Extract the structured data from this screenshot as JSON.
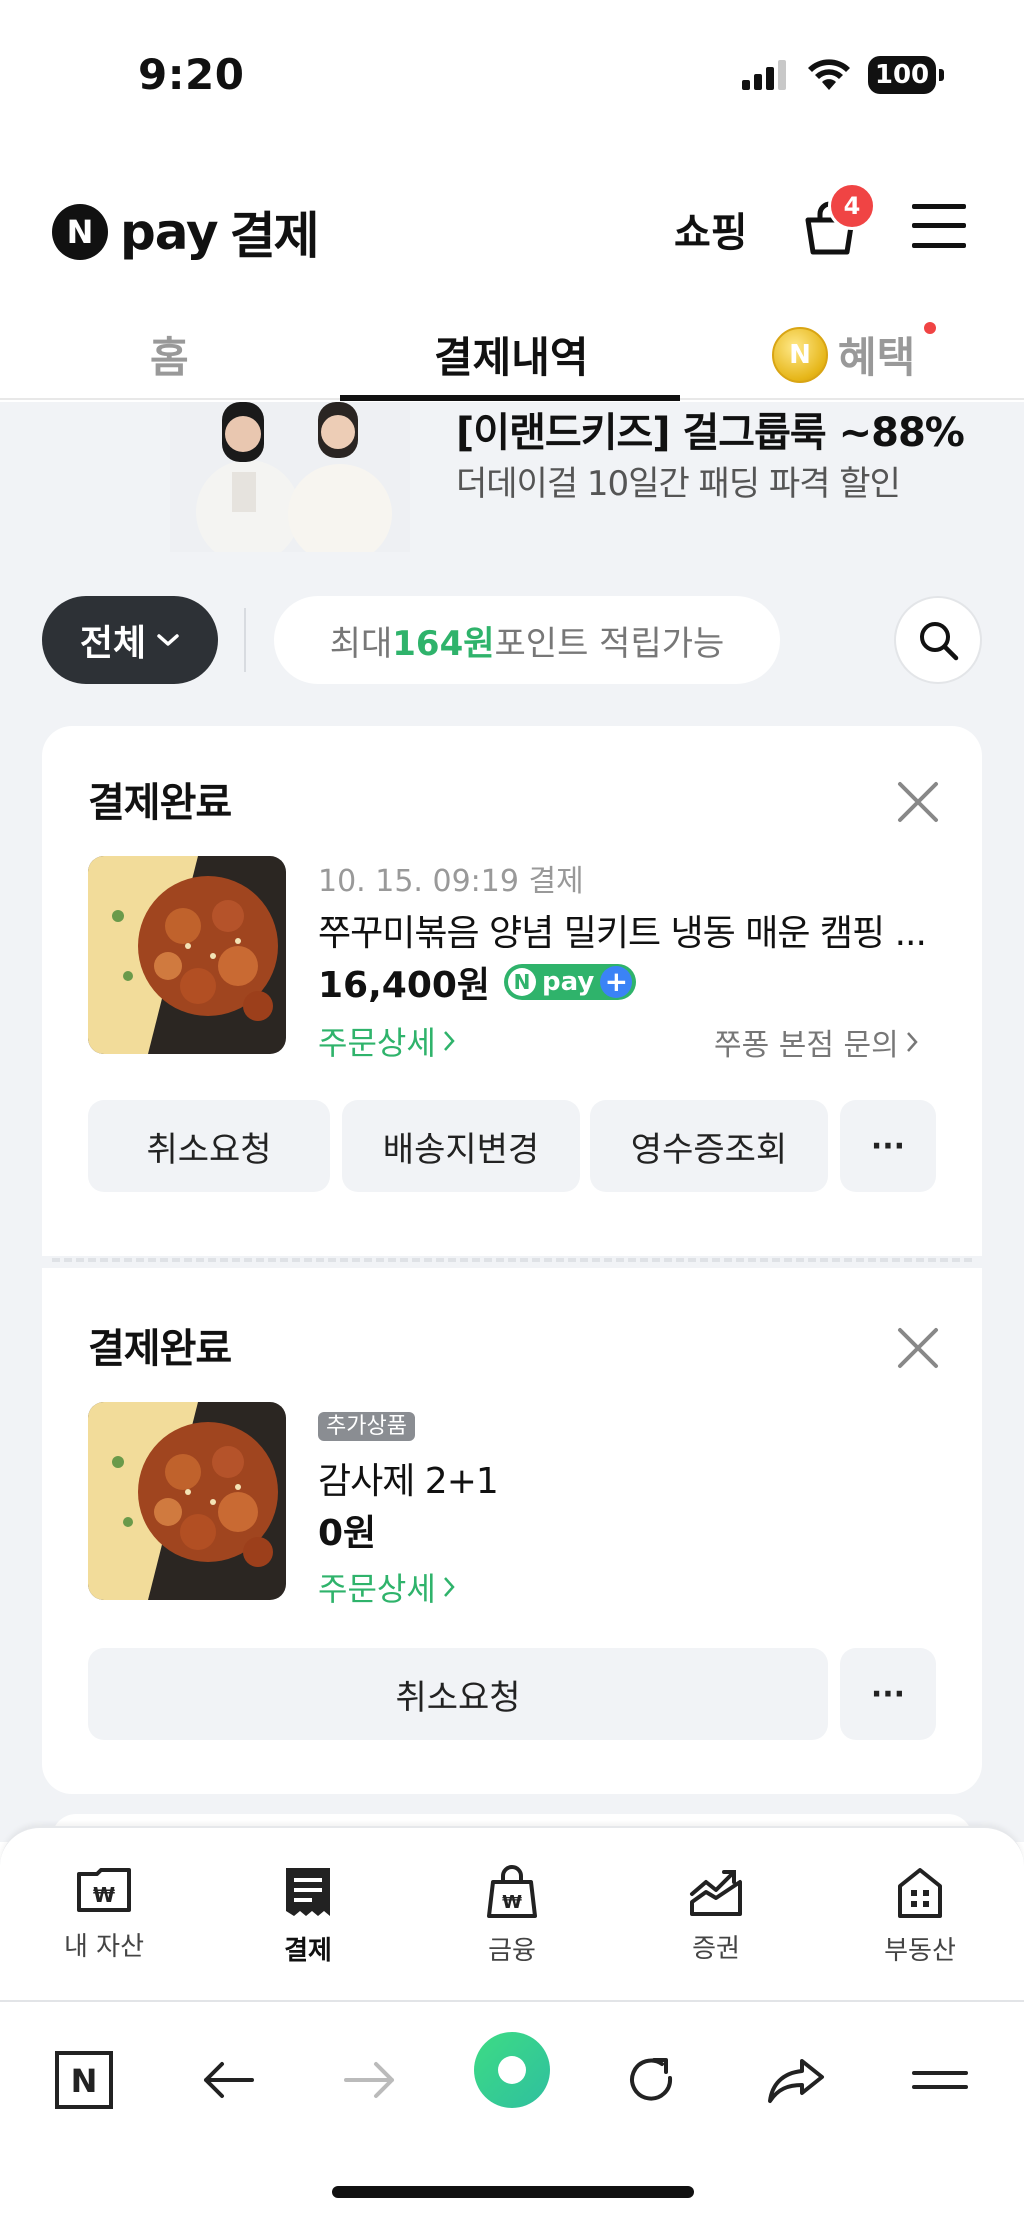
{
  "status_bar": {
    "time": "9:20",
    "battery": "100"
  },
  "header": {
    "brand_n": "N",
    "brand_pay": "pay",
    "brand_title": "결제",
    "shopping_label": "쇼핑",
    "cart_count": "4"
  },
  "tabs": [
    {
      "label": "홈"
    },
    {
      "label": "결제내역"
    },
    {
      "label": "혜택",
      "coin": "N"
    }
  ],
  "banner": {
    "title": "[이랜드키즈] 걸그룹룩 ~88%",
    "subtitle": "더데이걸 10일간 패딩 파격 할인"
  },
  "filter": {
    "all_label": "전체",
    "points_prefix": "최대 ",
    "points_amount": "164원",
    "points_suffix": " 포인트 적립가능"
  },
  "orders": [
    {
      "status": "결제완료",
      "date": "10. 15. 09:19 결제",
      "name": "쭈꾸미볶음 양념 밀키트 냉동 매운 캠핑 ...",
      "price": "16,400원",
      "badge_n": "N",
      "badge_pay": "pay",
      "badge_plus": "+",
      "detail_link": "주문상세",
      "store_inquiry": "쭈퐁 본점 문의",
      "actions": [
        "취소요청",
        "배송지변경",
        "영수증조회"
      ],
      "more_label": "···"
    },
    {
      "status": "결제완료",
      "tag": "추가상품",
      "name": "감사제 2+1",
      "price": "0원",
      "detail_link": "주문상세",
      "actions": [
        "취소요청"
      ],
      "more_label": "···"
    }
  ],
  "bottom_nav": [
    {
      "label": "내 자산",
      "icon": "wallet-icon"
    },
    {
      "label": "결제",
      "icon": "receipt-icon",
      "active": true
    },
    {
      "label": "금융",
      "icon": "money-bag-icon"
    },
    {
      "label": "증권",
      "icon": "stock-chart-icon"
    },
    {
      "label": "부동산",
      "icon": "building-icon"
    }
  ],
  "browser_bar": {
    "home_letter": "N"
  },
  "colors": {
    "accent_green": "#2fb36b",
    "dark_pill": "#2d3136",
    "badge_red": "#f04444",
    "background": "#f1f3f6"
  }
}
